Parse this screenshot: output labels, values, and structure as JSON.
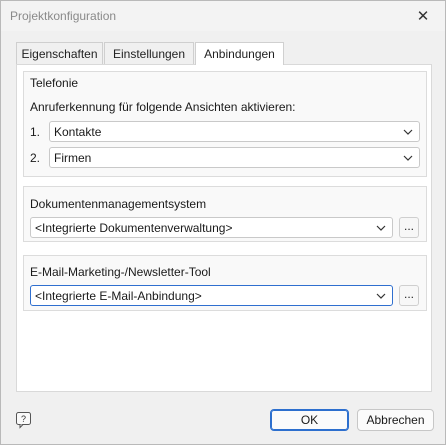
{
  "window": {
    "title": "Projektkonfiguration",
    "close_glyph": "✕"
  },
  "tabs": [
    {
      "label": "Eigenschaften",
      "active": false
    },
    {
      "label": "Einstellungen",
      "active": false
    },
    {
      "label": "Anbindungen",
      "active": true
    }
  ],
  "telefonie": {
    "group_label": "Telefonie",
    "caption": "Anruferkennung für folgende Ansichten aktivieren:",
    "rows": [
      {
        "number": "1.",
        "value": "Kontakte"
      },
      {
        "number": "2.",
        "value": "Firmen"
      }
    ]
  },
  "dms": {
    "group_label": "Dokumentenmanagementsystem",
    "value": "<Integrierte Dokumentenverwaltung>",
    "browse_label": "..."
  },
  "email": {
    "group_label": "E-Mail-Marketing-/Newsletter-Tool",
    "value": "<Integrierte E-Mail-Anbindung>",
    "browse_label": "..."
  },
  "footer": {
    "help_icon": "help-icon",
    "ok_label": "OK",
    "cancel_label": "Abbrechen"
  },
  "colors": {
    "accent": "#2d6fce",
    "window_bg": "#f0f0f0",
    "panel_bg": "#ffffff"
  }
}
